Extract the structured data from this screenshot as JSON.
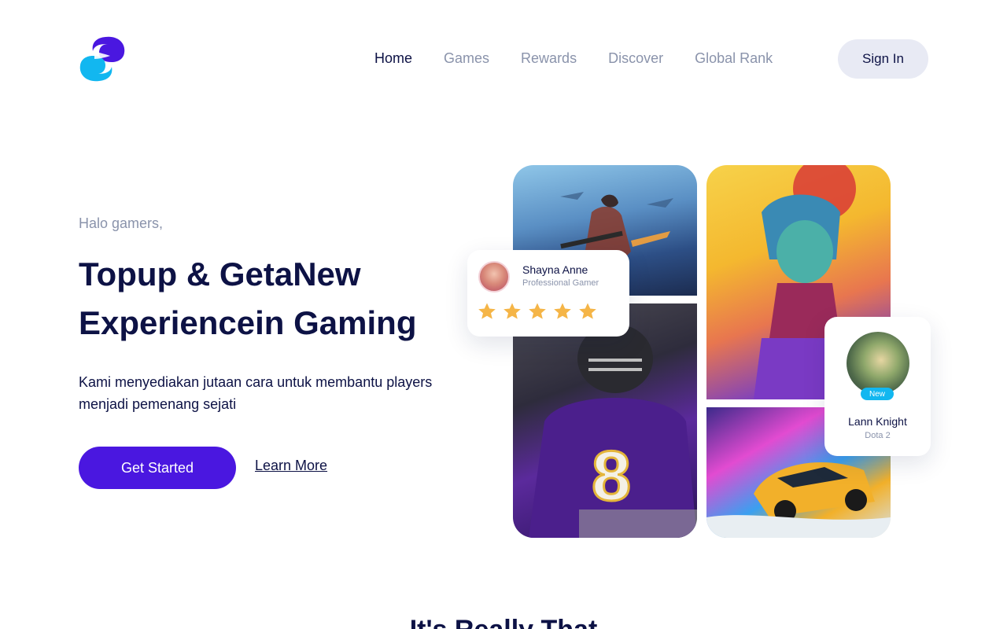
{
  "nav": {
    "items": [
      "Home",
      "Games",
      "Rewards",
      "Discover",
      "Global Rank"
    ],
    "active": "Home",
    "signin_label": "Sign In"
  },
  "hero": {
    "greeting": "Halo gamers,",
    "headline_part1": "Topup & Geta",
    "headline_highlight1": " New",
    "headline_highlight2": "Experience",
    "headline_part2": "in Gaming",
    "description": "Kami menyediakan jutaan cara untuk membantu players menjadi pemenang sejati",
    "primary_cta": "Get Started",
    "secondary_cta": "Learn More"
  },
  "cards": {
    "shayna": {
      "name": "Shayna Anne",
      "role": "Professional Gamer",
      "rating": 5
    },
    "lann": {
      "badge": "New",
      "name": "Lann Knight",
      "game": "Dota 2"
    }
  },
  "section": {
    "title": "It's Really That"
  },
  "colors": {
    "primary": "#4a17e0",
    "accent": "#2fb7ee",
    "star": "#f5b547",
    "text": "#0d1245",
    "muted": "#8a93ab"
  },
  "icons": {
    "logo": "brand-s-logo",
    "star": "star-icon"
  }
}
